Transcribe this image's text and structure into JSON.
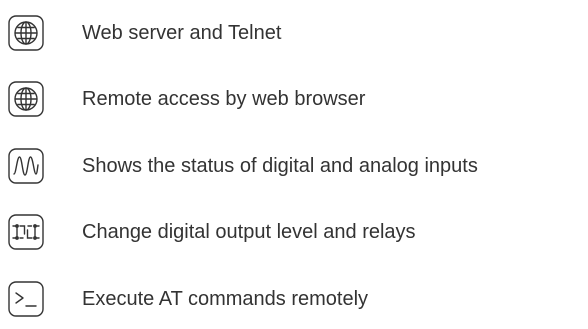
{
  "features": [
    {
      "icon": "globe-icon",
      "label": "Web server and Telnet"
    },
    {
      "icon": "globe-icon",
      "label": "Remote access by web browser"
    },
    {
      "icon": "waveform-icon",
      "label": "Shows the status of digital and analog inputs"
    },
    {
      "icon": "relay-switch-icon",
      "label": "Change digital output level and relays"
    },
    {
      "icon": "terminal-prompt-icon",
      "label": "Execute AT commands remotely"
    }
  ],
  "colors": {
    "text": "#333333",
    "icon_stroke": "#333333",
    "background": "#ffffff"
  }
}
